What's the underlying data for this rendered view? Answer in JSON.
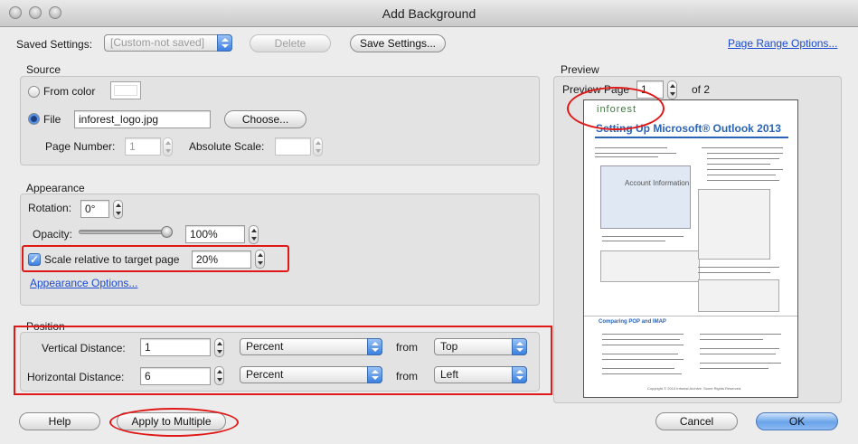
{
  "window": {
    "title": "Add Background"
  },
  "saved_settings": {
    "label": "Saved Settings:",
    "value": "[Custom-not saved]",
    "delete_label": "Delete",
    "save_label": "Save Settings...",
    "page_range_link": "Page Range Options..."
  },
  "source": {
    "title": "Source",
    "from_color_label": "From color",
    "file_label": "File",
    "file_value": "inforest_logo.jpg",
    "choose_label": "Choose...",
    "page_number_label": "Page Number:",
    "page_number_value": "1",
    "absolute_scale_label": "Absolute Scale:",
    "absolute_scale_value": ""
  },
  "appearance": {
    "title": "Appearance",
    "rotation_label": "Rotation:",
    "rotation_value": "0°",
    "opacity_label": "Opacity:",
    "opacity_value": "100%",
    "opacity_level": 1.0,
    "scale_label": "Scale relative to target page",
    "scale_value": "20%",
    "options_link": "Appearance Options..."
  },
  "position": {
    "title": "Position",
    "vertical_label": "Vertical Distance:",
    "vertical_value": "1",
    "vertical_unit": "Percent",
    "vertical_from_label": "from",
    "vertical_from": "Top",
    "horizontal_label": "Horizontal Distance:",
    "horizontal_value": "6",
    "horizontal_unit": "Percent",
    "horizontal_from_label": "from",
    "horizontal_from": "Left"
  },
  "preview": {
    "title": "Preview",
    "page_label": "Preview Page",
    "page_value": "1",
    "page_total": "of 2",
    "doc_logo": "inforest",
    "doc_title": "Setting Up Microsoft® Outlook 2013",
    "doc_subheading": "Account Information",
    "doc_section": "Comparing POP and IMAP",
    "doc_footer": "Copyright © 2014 Inforest Archive. Some Rights Reserved."
  },
  "footer": {
    "help_label": "Help",
    "apply_multiple_label": "Apply to Multiple",
    "cancel_label": "Cancel",
    "ok_label": "OK"
  },
  "colors": {
    "accent": "#3b7fe0",
    "link": "#1a4bd0",
    "highlight": "#e01818",
    "doc_heading": "#2a64b6"
  }
}
